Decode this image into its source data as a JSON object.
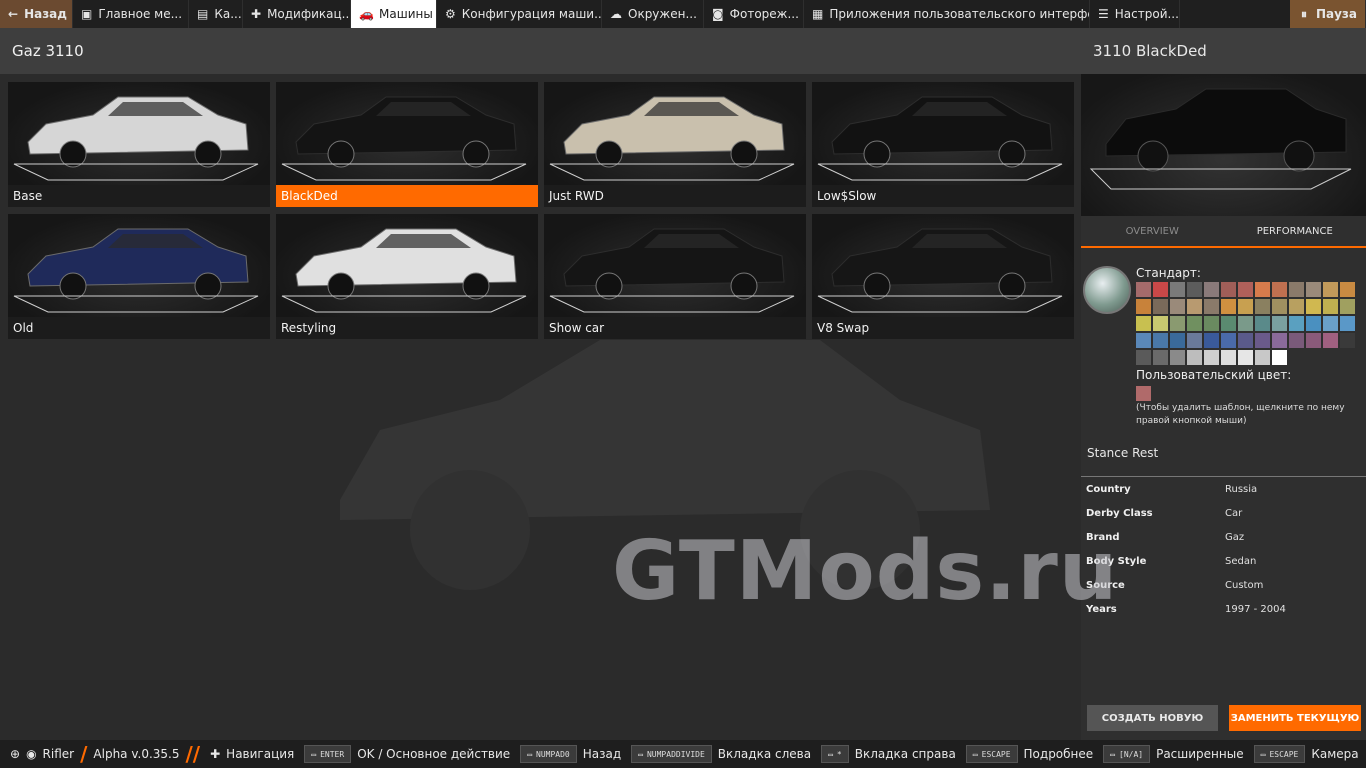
{
  "topbar": {
    "back": "Назад",
    "tabs": [
      {
        "label": "Главное ме...",
        "icon": "main-menu-icon"
      },
      {
        "label": "Ка...",
        "icon": "map-icon"
      },
      {
        "label": "Модификац...",
        "icon": "puzzle-icon"
      },
      {
        "label": "Машины",
        "icon": "car-icon"
      },
      {
        "label": "Конфигурация маши...",
        "icon": "engine-icon"
      },
      {
        "label": "Окружен...",
        "icon": "weather-icon"
      },
      {
        "label": "Фотореж...",
        "icon": "camera-icon"
      },
      {
        "label": "Приложения пользовательского интерфе...",
        "icon": "apps-icon"
      },
      {
        "label": "Настрой...",
        "icon": "settings-icon"
      }
    ],
    "pause": "Пауза"
  },
  "header": {
    "title": "Gaz 3110"
  },
  "configs": [
    {
      "label": "Base",
      "color": "#d6d6d6"
    },
    {
      "label": "BlackDed",
      "color": "#141414"
    },
    {
      "label": "Just RWD",
      "color": "#c9c0ad"
    },
    {
      "label": "Low$Slow",
      "color": "#121212"
    },
    {
      "label": "Old",
      "color": "#1f2a5a"
    },
    {
      "label": "Restyling",
      "color": "#e0e0e0"
    },
    {
      "label": "Show car",
      "color": "#151515"
    },
    {
      "label": "V8 Swap",
      "color": "#161616"
    }
  ],
  "selected_config": "BlackDed",
  "panel": {
    "title": "3110 BlackDed",
    "tab_overview": "OVERVIEW",
    "tab_performance": "PERFORMANCE",
    "standard_label": "Стандарт:",
    "custom_label": "Пользовательский цвет:",
    "hint": "(Чтобы удалить шаблон, щелкните по нему правой кнопкой мыши)",
    "stance": "Stance Rest",
    "info": [
      {
        "k": "Country",
        "v": "Russia"
      },
      {
        "k": "Derby Class",
        "v": "Car"
      },
      {
        "k": "Brand",
        "v": "Gaz"
      },
      {
        "k": "Body Style",
        "v": "Sedan"
      },
      {
        "k": "Source",
        "v": "Custom"
      },
      {
        "k": "Years",
        "v": "1997 - 2004"
      }
    ],
    "btn_new": "СОЗДАТЬ НОВУЮ",
    "btn_replace": "ЗАМЕНИТЬ ТЕКУЩУЮ"
  },
  "palette": [
    "#a56b6b",
    "#c94848",
    "#7a7a7a",
    "#5c5c5c",
    "#8a7a7a",
    "#a05e58",
    "#b0605a",
    "#d77b4c",
    "#c07050",
    "#8a7a6a",
    "#9a8a7a",
    "#c29a5a",
    "#c88a42",
    "#c8823a",
    "#7a6a5a",
    "#9a8a7a",
    "#b89a70",
    "#8a7a6a",
    "#d09040",
    "#c8a050",
    "#8a8060",
    "#a09060",
    "#b8a060",
    "#d0b850",
    "#c0b050",
    "#a0a060",
    "#c8c050",
    "#c8c870",
    "#8a9a70",
    "#709060",
    "#6a8a60",
    "#5a8a70",
    "#7a9a8a",
    "#5a8a8a",
    "#7aa0a0",
    "#5aa0c0",
    "#4a90c0",
    "#6aa0c8",
    "#5a98c8",
    "#5a88b8",
    "#4a78a8",
    "#3a6a9a",
    "#6a7a9a",
    "#3a5a9a",
    "#4a6aaa",
    "#5a5a8a",
    "#6a5a8a",
    "#8a6a9a",
    "#7a5a7a",
    "#8a5a7a",
    "#a06080",
    "#3a3a3a",
    "#5a5a5a",
    "#6a6a6a",
    "#8a8a8a",
    "#bdbdbd",
    "#cfcfcf",
    "#dedede",
    "#e6e6e6",
    "#c8c8c8",
    "#ffffff"
  ],
  "custom_color": "#b06a6a",
  "watermark": "GTMods.ru",
  "bottom": {
    "user": "Rifler",
    "version": "Alpha v.0.35.5",
    "items": [
      {
        "key": "",
        "label": "Навигация"
      },
      {
        "key": "ENTER",
        "label": "OK / Основное действие"
      },
      {
        "key": "NUMPAD0",
        "label": "Назад"
      },
      {
        "key": "NUMPADDIVIDE",
        "label": "Вкладка слева"
      },
      {
        "key": "*",
        "label": "Вкладка справа"
      },
      {
        "key": "ESCAPE",
        "label": "Подробнее"
      },
      {
        "key": "[N/A]",
        "label": "Расширенные"
      },
      {
        "key": "ESCAPE",
        "label": "Камера"
      }
    ]
  }
}
